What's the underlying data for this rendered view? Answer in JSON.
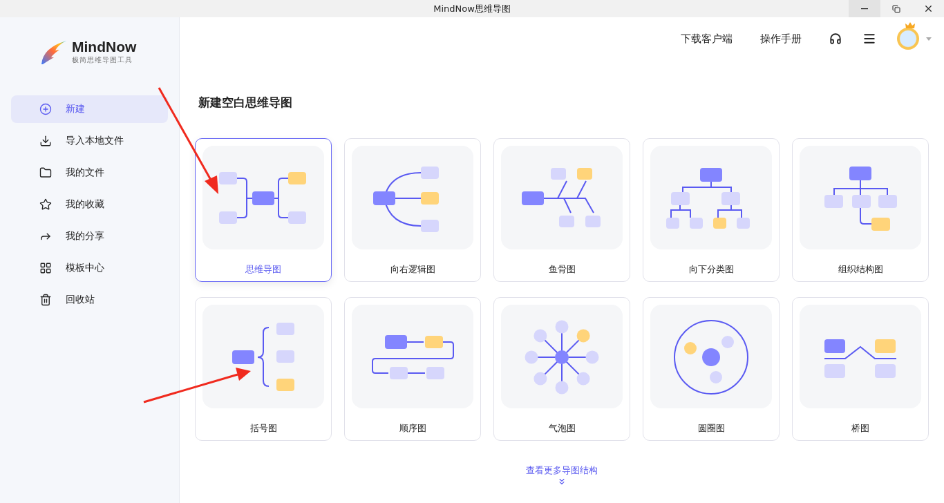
{
  "window": {
    "title": "MindNow思维导图"
  },
  "logo": {
    "name": "MindNow",
    "tagline": "极简思维导图工具"
  },
  "sidebar": {
    "items": [
      {
        "label": "新建",
        "selected": true
      },
      {
        "label": "导入本地文件",
        "selected": false
      },
      {
        "label": "我的文件",
        "selected": false
      },
      {
        "label": "我的收藏",
        "selected": false
      },
      {
        "label": "我的分享",
        "selected": false
      },
      {
        "label": "模板中心",
        "selected": false
      },
      {
        "label": "回收站",
        "selected": false
      }
    ]
  },
  "header": {
    "links": [
      "下载客户端",
      "操作手册"
    ]
  },
  "section_title": "新建空白思维导图",
  "templates": [
    {
      "label": "思维导图",
      "kind": "mindmap",
      "selected": true
    },
    {
      "label": "向右逻辑图",
      "kind": "logic",
      "selected": false
    },
    {
      "label": "鱼骨图",
      "kind": "fishbone",
      "selected": false
    },
    {
      "label": "向下分类图",
      "kind": "treedown",
      "selected": false
    },
    {
      "label": "组织结构图",
      "kind": "org",
      "selected": false
    },
    {
      "label": "括号图",
      "kind": "bracket",
      "selected": false
    },
    {
      "label": "顺序图",
      "kind": "sequence",
      "selected": false
    },
    {
      "label": "气泡图",
      "kind": "bubble",
      "selected": false
    },
    {
      "label": "圆圈图",
      "kind": "circle",
      "selected": false
    },
    {
      "label": "桥图",
      "kind": "bridge",
      "selected": false
    }
  ],
  "more_link": "查看更多导图结构"
}
